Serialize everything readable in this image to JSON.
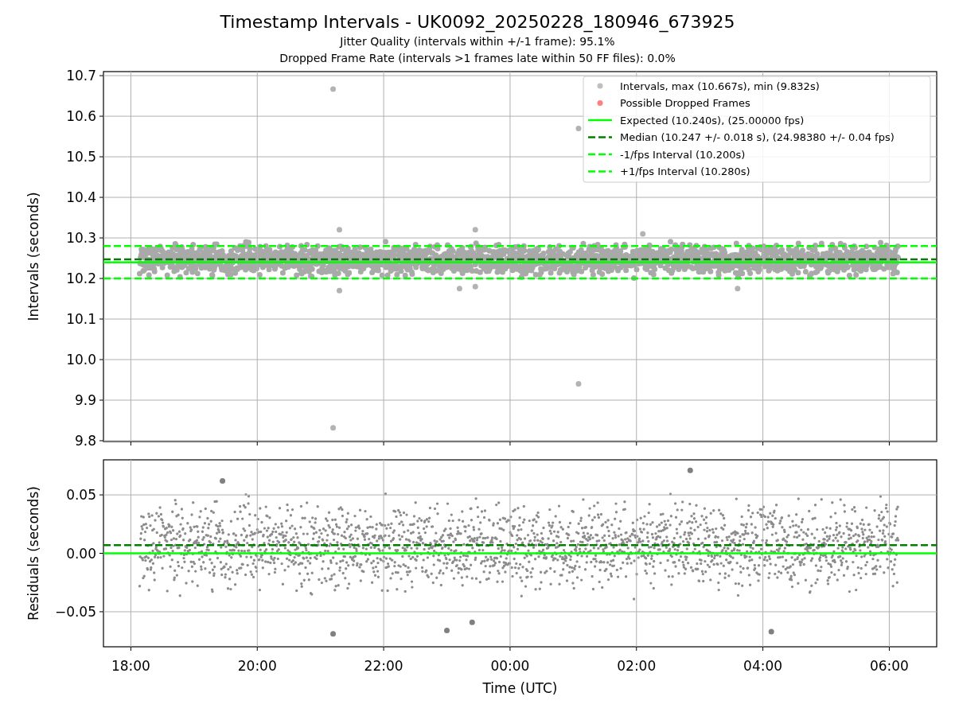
{
  "figure": {
    "title": "Timestamp Intervals - UK0092_20250228_180946_673925",
    "subtitles": [
      "Jitter Quality (intervals within +/-1 frame): 95.1%",
      "Dropped Frame Rate (intervals >1 frames late within 50 FF files): 0.0%"
    ]
  },
  "top_plot": {
    "chart_data": {
      "type": "scatter",
      "grid": true,
      "legend": true,
      "ylabel": "Intervals (seconds)",
      "xlim": [
        "2025-02-28T17:34",
        "2025-03-01T06:45"
      ],
      "ylim": [
        9.798,
        10.71
      ],
      "yticks": [
        {
          "value": 9.8,
          "label": "9.8"
        },
        {
          "value": 9.9,
          "label": "9.9"
        },
        {
          "value": 10.0,
          "label": "10.0"
        },
        {
          "value": 10.1,
          "label": "10.1"
        },
        {
          "value": 10.2,
          "label": "10.2"
        },
        {
          "value": 10.3,
          "label": "10.3"
        },
        {
          "value": 10.4,
          "label": "10.4"
        },
        {
          "value": 10.5,
          "label": "10.5"
        },
        {
          "value": 10.6,
          "label": "10.6"
        },
        {
          "value": 10.7,
          "label": "10.7"
        }
      ],
      "series": [
        {
          "name": "Intervals, max (10.667s), min (9.832s)",
          "type": "scatter",
          "color": "#808080",
          "x": [
            "2025-02-28T21:12",
            "2025-02-28T21:12",
            "2025-03-01T01:05",
            "2025-03-01T01:05",
            "2025-02-28T21:18",
            "2025-02-28T21:18",
            "2025-02-28T23:27",
            "2025-02-28T23:27",
            "2025-02-28T23:12",
            "2025-03-01T02:06",
            "2025-03-01T03:36"
          ],
          "values": [
            10.667,
            9.832,
            10.57,
            9.94,
            10.32,
            10.17,
            10.32,
            10.18,
            10.175,
            10.31,
            10.175
          ]
        },
        {
          "name": "Possible Dropped Frames",
          "type": "scatter",
          "color": "#ff0000"
        },
        {
          "name": "Expected (10.240s), (25.00000 fps)",
          "type": "line",
          "line_style": "solid",
          "color": "#00ff00",
          "x": [
            "2025-02-28T17:34",
            "2025-03-01T06:45"
          ],
          "values": [
            10.24,
            10.24
          ]
        },
        {
          "name": "Median (10.247 +/- 0.018 s), (24.98380 +/- 0.04 fps)",
          "type": "line",
          "line_style": "dashed",
          "color": "#008000",
          "x": [
            "2025-02-28T17:34",
            "2025-03-01T06:45"
          ],
          "values": [
            10.247,
            10.247
          ]
        },
        {
          "name": "-1/fps Interval (10.200s)",
          "type": "line",
          "line_style": "dashed",
          "color": "#00ff00",
          "x": [
            "2025-02-28T17:34",
            "2025-03-01T06:45"
          ],
          "values": [
            10.2,
            10.2
          ]
        },
        {
          "name": "+1/fps Interval (10.280s)",
          "type": "line",
          "line_style": "dashed",
          "color": "#00ff00",
          "x": [
            "2025-02-28T17:34",
            "2025-03-01T06:45"
          ],
          "values": [
            10.28,
            10.28
          ]
        }
      ]
    }
  },
  "bottom_plot": {
    "chart_data": {
      "type": "scatter",
      "xlabel": "Time (UTC)",
      "ylabel": "Residuals (seconds)",
      "xlim": [
        "2025-02-28T17:34",
        "2025-03-01T06:45"
      ],
      "ylim": [
        -0.08,
        0.08
      ],
      "grid": true,
      "xticks": [
        {
          "value": "2025-02-28T18:00",
          "label": "18:00"
        },
        {
          "value": "2025-02-28T20:00",
          "label": "20:00"
        },
        {
          "value": "2025-02-28T22:00",
          "label": "22:00"
        },
        {
          "value": "2025-03-01T00:00",
          "label": "00:00"
        },
        {
          "value": "2025-03-01T02:00",
          "label": "02:00"
        },
        {
          "value": "2025-03-01T04:00",
          "label": "04:00"
        },
        {
          "value": "2025-03-01T06:00",
          "label": "06:00"
        }
      ],
      "yticks": [
        {
          "value": -0.05,
          "label": "−0.05"
        },
        {
          "value": 0,
          "label": "0.00"
        },
        {
          "value": 0.05,
          "label": "0.05"
        }
      ],
      "series": [
        {
          "type": "scatter",
          "color": "#808080",
          "x": [
            "2025-02-28T21:12",
            "2025-02-28T23:00",
            "2025-02-28T23:24",
            "2025-03-01T04:08",
            "2025-03-01T02:51",
            "2025-02-28T19:27"
          ],
          "values": [
            -0.069,
            -0.066,
            -0.059,
            -0.067,
            0.071,
            0.062
          ]
        },
        {
          "type": "line",
          "line_style": "solid",
          "color": "#00ff00",
          "x": [
            "2025-02-28T17:34",
            "2025-03-01T06:45"
          ],
          "values": [
            0,
            0
          ]
        },
        {
          "type": "line",
          "line_style": "dashed",
          "color": "#008000",
          "x": [
            "2025-02-28T17:34",
            "2025-03-01T06:45"
          ],
          "values": [
            0.007,
            0.007
          ]
        }
      ]
    }
  }
}
